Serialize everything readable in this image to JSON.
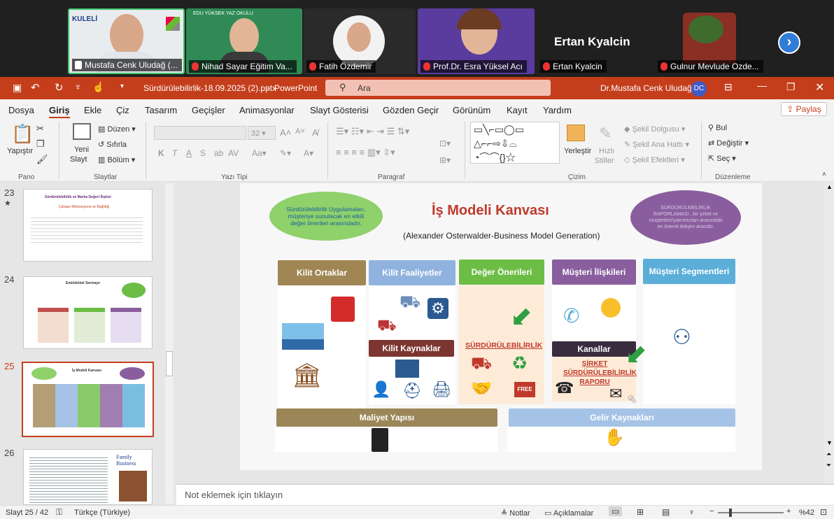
{
  "participants": [
    {
      "name": "Mustafa Cenk Uludağ (..."
    },
    {
      "name": "Nihad Sayar Eğitim Va..."
    },
    {
      "name": "Fatih Özdemir"
    },
    {
      "name": "Prof.Dr. Esra Yüksel Acı"
    },
    {
      "name": "Ertan Kyalcin",
      "big_label": "Ertan Kyalcin"
    },
    {
      "name": "Gulnur Mevlude Ozde..."
    }
  ],
  "tile_texts": {
    "kuleli": "KULELİ",
    "edu": "EDU YÜKSEK YAZ OKULU"
  },
  "titlebar": {
    "filename": "Sürdürülebilirlik-18.09.2025 (2).pptx",
    "app": "PowerPoint",
    "search_placeholder": "Ara",
    "user": "Dr.Mustafa Cenk Uludağ",
    "avatar": "DC"
  },
  "menu": {
    "tabs": [
      "Dosya",
      "Giriş",
      "Ekle",
      "Çiz",
      "Tasarım",
      "Geçişler",
      "Animasyonlar",
      "Slayt Gösterisi",
      "Gözden Geçir",
      "Görünüm",
      "Kayıt",
      "Yardım"
    ],
    "share": "Paylaş"
  },
  "ribbon": {
    "paste": "Yapıştır",
    "pano": "Pano",
    "new_slide": "Yeni",
    "new_slide2": "Slayt",
    "duzen": "Düzen",
    "sifirla": "Sıfırla",
    "bolum": "Bölüm",
    "slaytlar": "Slaytlar",
    "font_size": "32",
    "yazi_tipi": "Yazı Tipi",
    "paragraf": "Paragraf",
    "yerlestir": "Yerleştir",
    "hizli": "Hızlı",
    "stiller": "Stiller",
    "sekil_dolgusu": "Şekil Dolgusu",
    "sekil_ana_hatti": "Şekil Ana Hattı",
    "sekil_efektleri": "Şekil Efektleri",
    "cizim": "Çizim",
    "bul": "Bul",
    "degistir": "Değiştir",
    "sec": "Seç",
    "duzenleme": "Düzenleme"
  },
  "thumbnails": [
    {
      "num": "23",
      "title": "Sürdürülebilirlik ve Marka Değeri İlişkisi",
      "subtitle": "Çalışan Motivasyonu ve Bağlılığı"
    },
    {
      "num": "24",
      "title": "Entelektüel Sermaye"
    },
    {
      "num": "25",
      "title": "İş Modeli Kanvası"
    },
    {
      "num": "26",
      "title": "Family Business"
    }
  ],
  "slide": {
    "title": "İş Modeli Kanvası",
    "subtitle": "(Alexander Osterwalder-Business Model Generation)",
    "green_oval": "Sürdürülebilirlik Uygulamaları, müşteriye sunulacak en etkili değer önerileri arasındadır.",
    "purple_oval": "SÜRDÜRÜLEBİLİRLİK RAPORLAMASI , bir şirket ve müşterileri/yatırımcıları arasındaki en önemli iletişim aracıdır.",
    "kilit_ortaklar": "Kilit Ortaklar",
    "kilit_faaliyetler": "Kilit Faaliyetler",
    "deger_onerileri": "Değer Önerileri",
    "musteri_iliskileri": "Müşteri İlişkileri",
    "musteri_segmentleri": "Müşteri Segmentleri",
    "kilit_kaynaklar": "Kilit Kaynaklar",
    "kanallar": "Kanallar",
    "surdurulebilirlik": "SÜRDÜRÜLEBİLİRLİK",
    "sirket_raporu": "ŞİRKET SÜRDÜRÜLEBİLİRLİK RAPORU",
    "maliyet_yapisi": "Maliyet Yapısı",
    "gelir_kaynaklari": "Gelir Kaynakları",
    "free": "FREE"
  },
  "notes_placeholder": "Not eklemek için tıklayın",
  "status": {
    "slide_of": "Slayt 25 / 42",
    "language": "Türkçe (Türkiye)",
    "notlar": "Notlar",
    "aciklamalar": "Açıklamalar",
    "zoom": "%42"
  },
  "colors": {
    "titlebar": "#c43e1c",
    "kilit_ortaklar": "#a08654",
    "kilit_faaliyetler": "#8fb3de",
    "deger_onerileri": "#6cbd45",
    "musteri_iliskileri": "#8a5e9e",
    "musteri_segmentleri": "#5aaed8",
    "kilit_kaynaklar": "#7c3530",
    "maliyet": "#9b8658",
    "gelir": "#a5c3e6"
  }
}
